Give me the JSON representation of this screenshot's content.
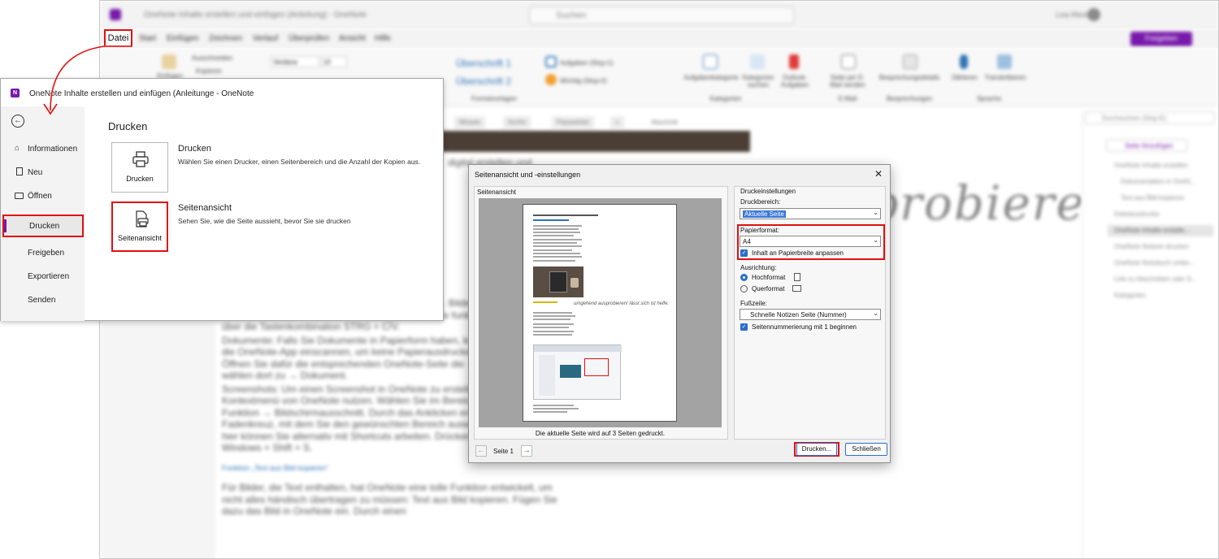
{
  "background_app": {
    "title": "OneNote Inhalte erstellen und einfügen (Anleitung) - OneNote",
    "search_placeholder": "Suchen",
    "user": "Lisa Mack",
    "menu": [
      "Datei",
      "Start",
      "Einfügen",
      "Zeichnen",
      "Verlauf",
      "Überprüfen",
      "Ansicht",
      "Hilfe"
    ],
    "share_label": "Freigeben",
    "ribbon": {
      "font_name": "Verdana",
      "font_size": "10",
      "style_h1": "Überschrift 1",
      "style_h2": "Überschrift 2",
      "group_formatvorlagen": "Formatvorlagen",
      "tag_aufgaben": "Aufgaben (Strg+1)",
      "tag_wichtig": "Wichtig (Strg+2)",
      "group_kategorien": "Kategorien",
      "btn_aufgabenkategorie": "Aufgabenkategorie",
      "btn_kategorien_suchen": "Kategorien suchen",
      "btn_outlook": "Outlook-Aufgaben",
      "btn_email": "Seite per E-Mail senden",
      "group_email": "E-Mail",
      "btn_besprechung": "Besprechungsdetails",
      "group_besprechungen": "Besprechungen",
      "btn_diktieren": "Diktieren",
      "btn_transkribieren": "Transkribieren",
      "group_sprache": "Sprache",
      "btn_einfuegen": "Einfügen",
      "btn_ausschneiden": "Ausschneiden",
      "btn_kopieren": "Kopieren"
    },
    "section_tabs": [
      "Wissen",
      "Archiv",
      "Passwörter",
      "+"
    ],
    "section_extra": "Abschnitt",
    "right_search_placeholder": "Durchsuchen (Strg+E)",
    "add_page_label": "Seite hinzufügen",
    "pages": [
      "OneNote Inhalte erstellen",
      "Dokumentation in OneN...",
      "Text aus Bild kopieren",
      "Dateiausdrucke",
      "OneNote Inhalte erstelle...",
      "OneNote Notizen drucken",
      "OneNote Notizbuch umbe...",
      "Link zu Abschnitten oder S...",
      "Kategorien"
    ],
    "heading_fragment": "digital erstellen und",
    "handwriting": "probieren !",
    "body_paragraphs": [
      "Bilder: Über das OneNote Menü → Einfügen und → Bilder können Sie Fotos und Screenshots in Ihren Notizen ablegen. Alternativ funktioniert das auch über die Tastenkombination STRG + C/V.",
      "Dokumente: Falls Sie Dokumente in Papierform haben, können Sie diese über die OneNote-App einscannen, um keine Papierausdrucke aufbewahren. Öffnen Sie dafür die entsprechenden OneNote-Seite die → Kamera und wählen dort zu → Dokument.",
      "Screenshots: Um einen Screenshot in OneNote zu erstellen können Sie das Kontextmenü von OneNote nutzen. Wählen Sie im Bereich → Einfügen die Funktion → Bildschirmausschnitt. Durch das Anklicken erscheint ein Fadenkreuz, mit dem Sie den gewünschten Bereich auswählen können. Auch hier können Sie alternativ mit Shortcuts arbeiten. Drücken Sie dafür → Windows + Shift + S.",
      "Funktion „Text aus Bild kopieren“",
      "Für Bilder, die Text enthalten, hat OneNote eine tolle Funktion entwickelt, um nicht alles händisch übertragen zu müssen: Text aus Bild kopieren. Fügen Sie dazu das Bild in OneNote ein. Durch einen"
    ]
  },
  "file_window": {
    "title": "OneNote Inhalte erstellen und einfügen (Anleitunge  -  OneNote",
    "app_icon": "N",
    "nav": {
      "informationen": "Informationen",
      "neu": "Neu",
      "oeffnen": "Öffnen",
      "drucken": "Drucken",
      "freigeben": "Freigeben",
      "exportieren": "Exportieren",
      "senden": "Senden"
    },
    "heading": "Drucken",
    "option_drucken": {
      "tile_label": "Drucken",
      "title": "Drucken",
      "description": "Wählen Sie einen Drucker, einen Seitenbereich und die Anzahl der Kopien aus."
    },
    "option_seitenansicht": {
      "tile_label": "Seitenansicht",
      "title": "Seitenansicht",
      "description": "Sehen Sie, wie die Seite aussieht, bevor Sie sie drucken"
    }
  },
  "dialog": {
    "title": "Seitenansicht und -einstellungen",
    "close": "✕",
    "preview_label": "Seitenansicht",
    "preview_status": "Die aktuelle Seite wird auf 3 Seiten gedruckt.",
    "page_label": "Seite 1",
    "preview_handwriting": "umgehend ausprobieren! lässt sich ist helfe.",
    "settings_label": "Druckeinstellungen",
    "druckbereich_label": "Druckbereich:",
    "druckbereich_value": "Aktuelle Seite",
    "papierformat_label": "Papierformat:",
    "papierformat_value": "A4",
    "fit_checkbox_label": "Inhalt an Papierbreite anpassen",
    "ausrichtung_label": "Ausrichtung:",
    "hochformat_label": "Hochformat",
    "querformat_label": "Querformat",
    "fusszeile_label": "Fußzeile:",
    "fusszeile_value": "Schnelle Notizen Seite (Nummer)",
    "numbering_checkbox_label": "Seitennummerierung mit 1 beginnen",
    "btn_drucken": "Drucken...",
    "btn_schliessen": "Schließen"
  },
  "colors": {
    "highlight_red": "#e01010",
    "onenote_purple": "#7719aa",
    "accent_blue": "#2a6fcc"
  }
}
